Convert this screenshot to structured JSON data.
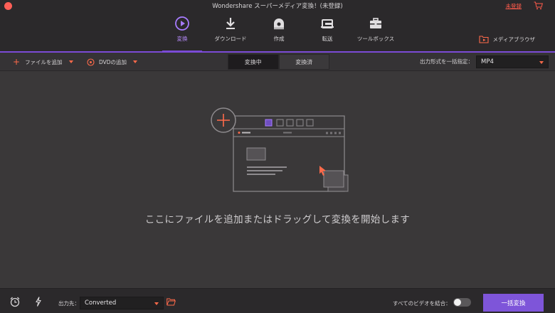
{
  "window": {
    "title": "Wondershare スーパーメディア変換！(未登録)",
    "unregistered_label": "未登録"
  },
  "nav": {
    "items": [
      {
        "label": "変換",
        "icon": "convert-icon",
        "active": true
      },
      {
        "label": "ダウンロード",
        "icon": "download-icon",
        "active": false
      },
      {
        "label": "作成",
        "icon": "burn-disc-icon",
        "active": false
      },
      {
        "label": "転送",
        "icon": "transfer-icon",
        "active": false
      },
      {
        "label": "ツールボックス",
        "icon": "toolbox-icon",
        "active": false
      }
    ],
    "media_browser_label": "メディアブラウザ"
  },
  "toolbar": {
    "add_files_label": "ファイルを追加",
    "add_dvd_label": "DVDの追加",
    "tabs": [
      "変換中",
      "変換済"
    ],
    "active_tab": "変換中",
    "output_format_label": "出力形式を一括指定：",
    "output_format_value": "MP4"
  },
  "main": {
    "drop_text": "ここにファイルを追加またはドラッグして変換を開始します"
  },
  "bottombar": {
    "output_label": "出力先：",
    "output_value": "Converted",
    "merge_label": "すべてのビデオを結合：",
    "merge_enabled": false,
    "convert_all_label": "一括変換"
  },
  "colors": {
    "accent": "#7e55d9",
    "warning": "#ff6a4a",
    "background": "#3a3839",
    "bar": "#2b292b"
  }
}
